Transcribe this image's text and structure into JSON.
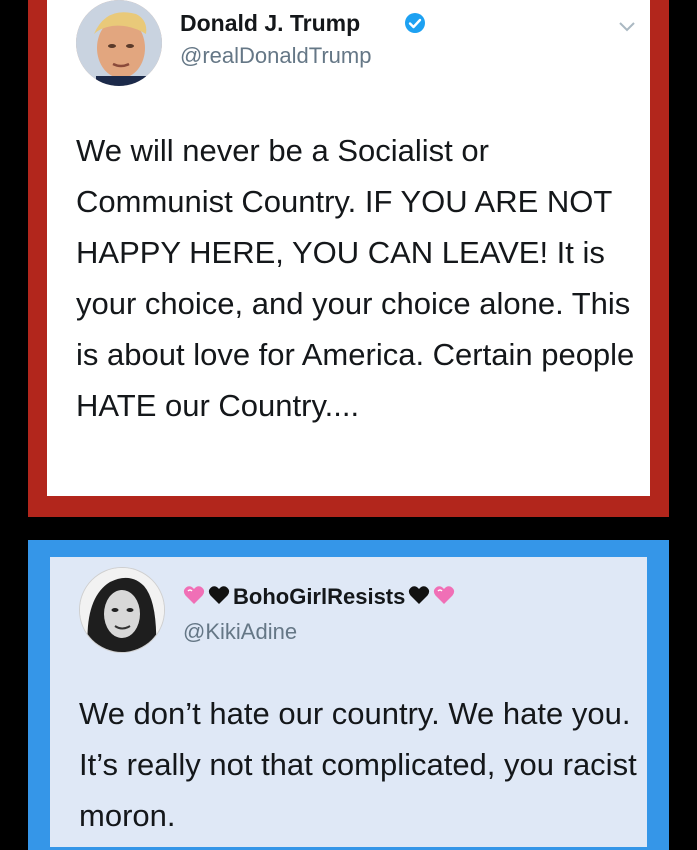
{
  "tweets": [
    {
      "display_name": "Donald J. Trump",
      "handle": "@realDonaldTrump",
      "verified_icon": "verified-badge-icon",
      "menu_icon": "chevron-down-icon",
      "text": "We will never be a Socialist or Communist Country. IF YOU ARE NOT HAPPY HERE, YOU CAN LEAVE! It is your choice, and your choice alone. This is about love for America. Certain people HATE our Country....",
      "frame_color": "#b2261c"
    },
    {
      "display_name": "BohoGirlResists",
      "name_emoji": [
        "pink-heart-icon",
        "black-heart-icon",
        "black-heart-icon",
        "pink-heart-icon"
      ],
      "handle": "@KikiAdine",
      "text": "We don’t hate our country. We hate you. It’s really not that complicated, you racist moron.",
      "frame_color": "#3596e8"
    }
  ],
  "colors": {
    "text": "#14171a",
    "secondary_text": "#657786",
    "verified_blue": "#1da1f2",
    "pink_heart": "#f06fb6"
  }
}
